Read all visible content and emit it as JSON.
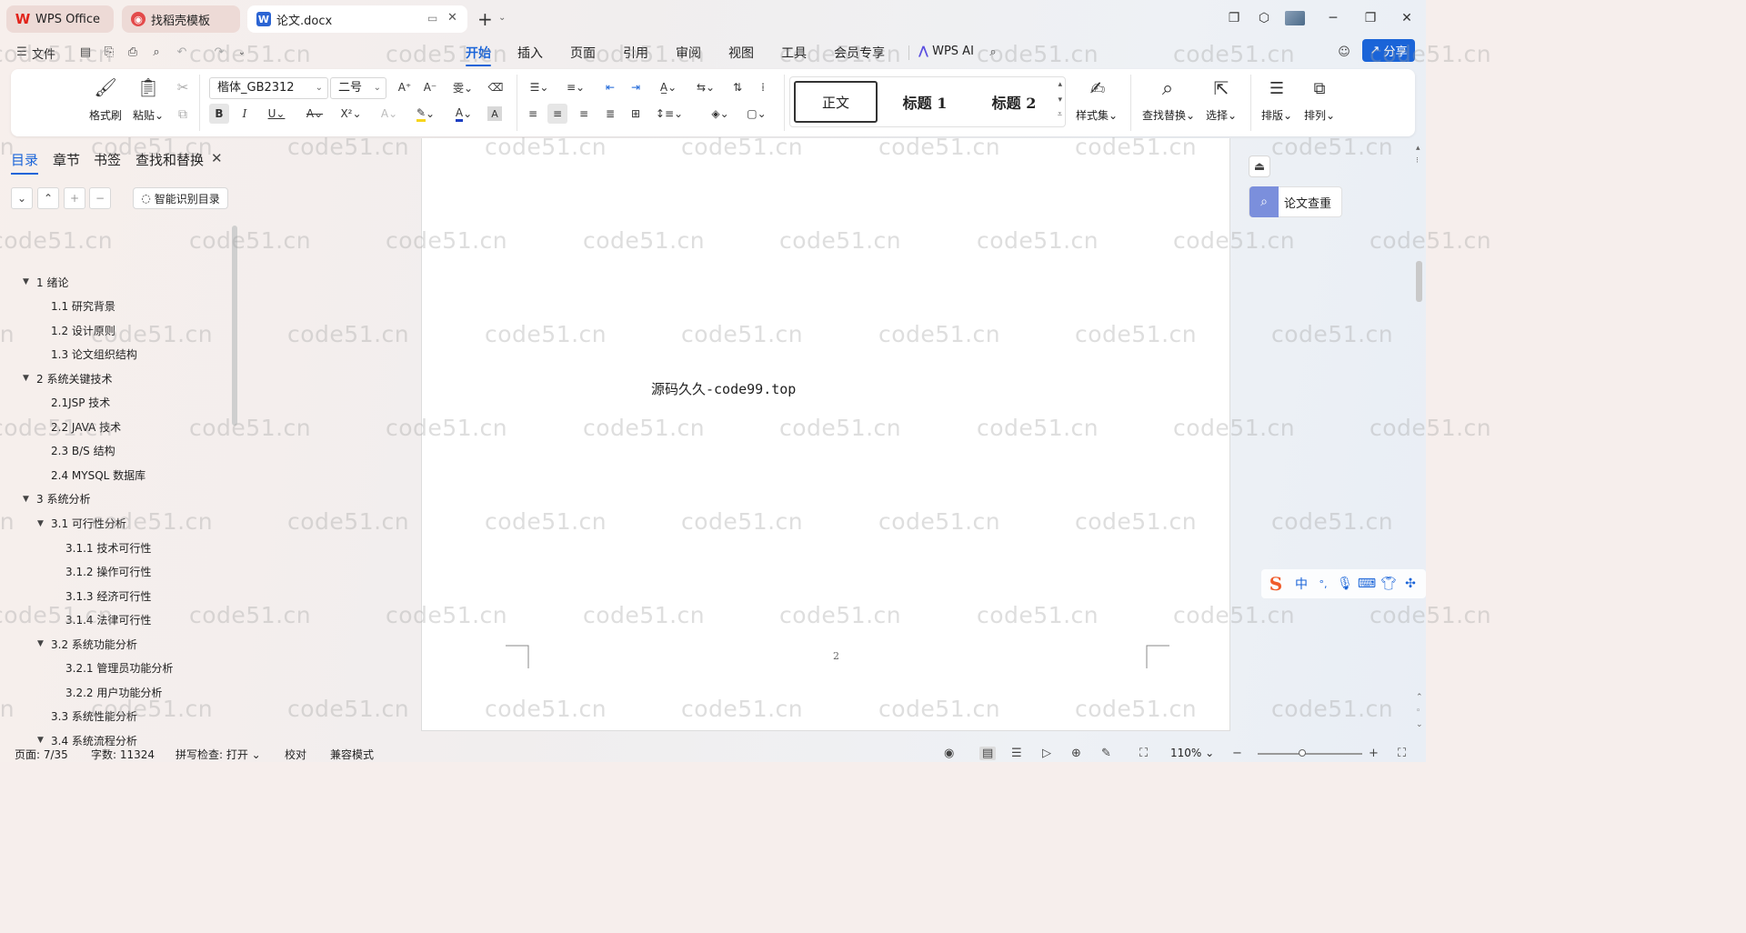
{
  "tabs": [
    {
      "label": "WPS Office",
      "icon": "wps-logo-icon"
    },
    {
      "label": "找稻壳模板",
      "icon": "docer-icon"
    },
    {
      "label": "论文.docx",
      "icon": "word-doc-icon"
    }
  ],
  "menu": {
    "file": "文件",
    "items": [
      "开始",
      "插入",
      "页面",
      "引用",
      "审阅",
      "视图",
      "工具",
      "会员专享"
    ],
    "active": "开始",
    "wps_ai": "WPS AI",
    "share": "分享"
  },
  "ribbon": {
    "format_painter": "格式刷",
    "paste": "粘贴",
    "font_name": "楷体_GB2312",
    "font_size": "二号",
    "styles": [
      "正文",
      "标题 1",
      "标题 2"
    ],
    "style_set": "样式集",
    "find_replace": "查找替换",
    "select": "选择",
    "layout": "排版",
    "arrange": "排列"
  },
  "nav": {
    "tabs": [
      "目录",
      "章节",
      "书签",
      "查找和替换"
    ],
    "smart_toc": "智能识别目录",
    "toc": [
      {
        "text": "1  绪论",
        "level": 1,
        "expandable": true
      },
      {
        "text": "1.1  研究背景",
        "level": 2
      },
      {
        "text": "1.2  设计原则",
        "level": 2
      },
      {
        "text": "1.3  论文组织结构",
        "level": 2
      },
      {
        "text": "2  系统关键技术",
        "level": 1,
        "expandable": true
      },
      {
        "text": "2.1JSP 技术",
        "level": 2
      },
      {
        "text": "2.2 JAVA 技术",
        "level": 2
      },
      {
        "text": "2.3 B/S 结构",
        "level": 2
      },
      {
        "text": "2.4 MYSQL 数据库",
        "level": 2
      },
      {
        "text": "3  系统分析",
        "level": 1,
        "expandable": true
      },
      {
        "text": "3.1  可行性分析",
        "level": 2,
        "expandable": true
      },
      {
        "text": "3.1.1  技术可行性",
        "level": 3
      },
      {
        "text": "3.1.2  操作可行性",
        "level": 3
      },
      {
        "text": "3.1.3  经济可行性",
        "level": 3
      },
      {
        "text": "3.1.4  法律可行性",
        "level": 3
      },
      {
        "text": "3.2 系统功能分析",
        "level": 2,
        "expandable": true
      },
      {
        "text": "3.2.1 管理员功能分析",
        "level": 3
      },
      {
        "text": "3.2.2 用户功能分析",
        "level": 3
      },
      {
        "text": "3.3 系统性能分析",
        "level": 2
      },
      {
        "text": "3.4  系统流程分析",
        "level": 2,
        "expandable": true
      }
    ]
  },
  "document": {
    "body_text": "源码久久-code99.top",
    "page_number": "2"
  },
  "side_panel": {
    "plagiarism_check": "论文查重"
  },
  "ime": {
    "mode": "中",
    "punct": "°,"
  },
  "status": {
    "page": "页面: 7/35",
    "words": "字数: 11324",
    "spellcheck": "拼写检查: 打开",
    "proof": "校对",
    "compat": "兼容模式",
    "zoom": "110%",
    "zoom_level": 0.43
  },
  "watermark_text": "code51.cn"
}
